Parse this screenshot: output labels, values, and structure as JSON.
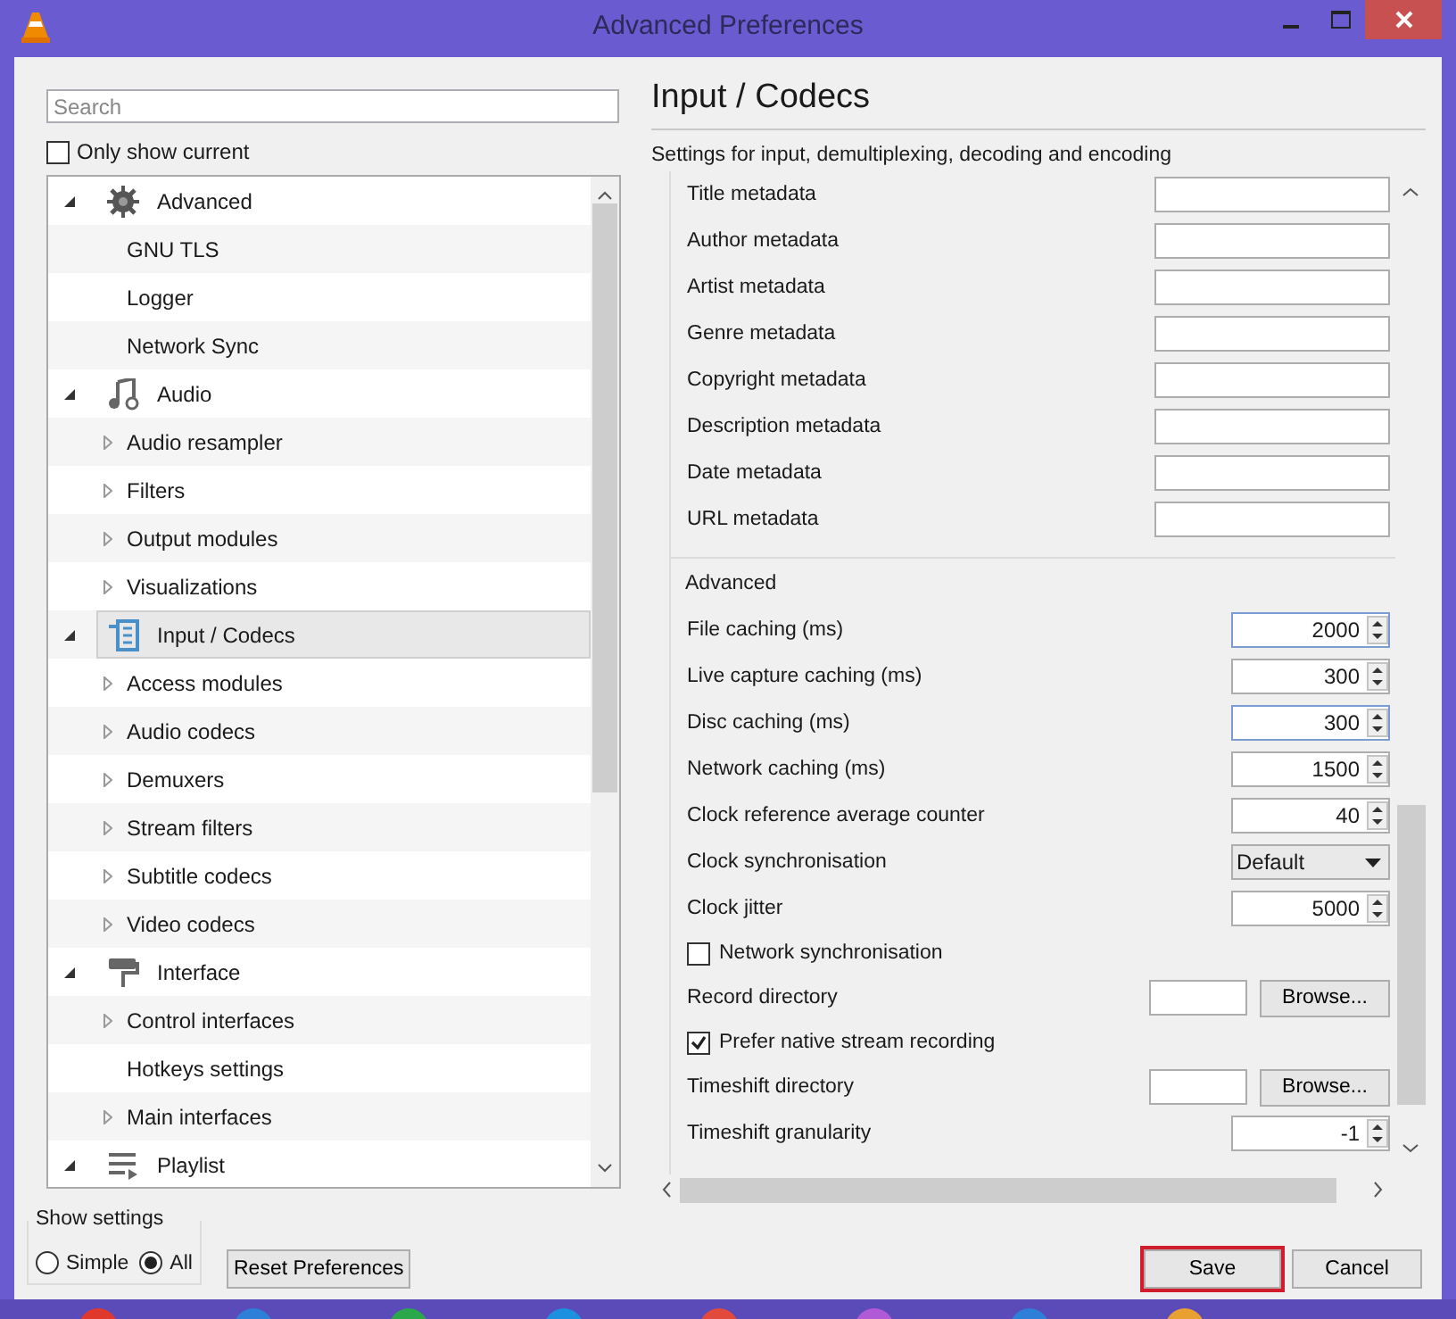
{
  "window": {
    "title": "Advanced Preferences"
  },
  "search": {
    "placeholder": "Search"
  },
  "only_show_current": {
    "label": "Only show current",
    "checked": false
  },
  "tree": [
    {
      "label": "Advanced",
      "expanded": true,
      "selected": false,
      "children": [
        {
          "label": "GNU TLS",
          "expandable": false,
          "selected": false
        },
        {
          "label": "Logger",
          "expandable": false,
          "selected": false
        },
        {
          "label": "Network Sync",
          "expandable": false,
          "selected": false
        }
      ]
    },
    {
      "label": "Audio",
      "expanded": true,
      "selected": false,
      "children": [
        {
          "label": "Audio resampler",
          "expandable": true,
          "selected": false
        },
        {
          "label": "Filters",
          "expandable": true,
          "selected": false
        },
        {
          "label": "Output modules",
          "expandable": true,
          "selected": false
        },
        {
          "label": "Visualizations",
          "expandable": true,
          "selected": false
        }
      ]
    },
    {
      "label": "Input / Codecs",
      "expanded": true,
      "selected": true,
      "children": [
        {
          "label": "Access modules",
          "expandable": true,
          "selected": false
        },
        {
          "label": "Audio codecs",
          "expandable": true,
          "selected": false
        },
        {
          "label": "Demuxers",
          "expandable": true,
          "selected": false
        },
        {
          "label": "Stream filters",
          "expandable": true,
          "selected": false
        },
        {
          "label": "Subtitle codecs",
          "expandable": true,
          "selected": false
        },
        {
          "label": "Video codecs",
          "expandable": true,
          "selected": false
        }
      ]
    },
    {
      "label": "Interface",
      "expanded": true,
      "selected": false,
      "children": [
        {
          "label": "Control interfaces",
          "expandable": true,
          "selected": false
        },
        {
          "label": "Hotkeys settings",
          "expandable": false,
          "selected": false
        },
        {
          "label": "Main interfaces",
          "expandable": true,
          "selected": false
        }
      ]
    },
    {
      "label": "Playlist",
      "expanded": true,
      "selected": false
    }
  ],
  "page": {
    "title": "Input / Codecs",
    "description": "Settings for input, demultiplexing, decoding and encoding"
  },
  "settings": [
    {
      "kind": "text",
      "label": "Title metadata"
    },
    {
      "kind": "text",
      "label": "Author metadata"
    },
    {
      "kind": "text",
      "label": "Artist metadata"
    },
    {
      "kind": "text",
      "label": "Genre metadata"
    },
    {
      "kind": "text",
      "label": "Copyright metadata"
    },
    {
      "kind": "text",
      "label": "Description metadata"
    },
    {
      "kind": "text",
      "label": "Date metadata"
    },
    {
      "kind": "text",
      "label": "URL metadata"
    },
    {
      "kind": "section",
      "label": "Advanced"
    },
    {
      "kind": "spin",
      "label": "File caching (ms)",
      "value": "2000",
      "focused": true
    },
    {
      "kind": "spin",
      "label": "Live capture caching (ms)",
      "value": "300",
      "focused": false
    },
    {
      "kind": "spin",
      "label": "Disc caching (ms)",
      "value": "300",
      "focused": true
    },
    {
      "kind": "spin",
      "label": "Network caching (ms)",
      "value": "1500",
      "focused": false
    },
    {
      "kind": "spin",
      "label": "Clock reference average counter",
      "value": "40",
      "focused": false
    },
    {
      "kind": "dropdown",
      "label": "Clock synchronisation",
      "value": "Default"
    },
    {
      "kind": "spin",
      "label": "Clock jitter",
      "value": "5000",
      "focused": false
    },
    {
      "kind": "checkbox",
      "label": "Network synchronisation",
      "checked": false
    },
    {
      "kind": "directory",
      "label": "Record directory",
      "button": "Browse..."
    },
    {
      "kind": "checkbox",
      "label": "Prefer native stream recording",
      "checked": true
    },
    {
      "kind": "directory",
      "label": "Timeshift directory",
      "button": "Browse..."
    },
    {
      "kind": "spin",
      "label": "Timeshift granularity",
      "value": "-1",
      "focused": false
    }
  ],
  "show_settings": {
    "label": "Show settings",
    "options": [
      {
        "label": "Simple",
        "selected": false
      },
      {
        "label": "All",
        "selected": true
      }
    ]
  },
  "buttons": [
    {
      "kind": "reset",
      "label": "Reset Preferences"
    },
    {
      "kind": "save",
      "label": "Save",
      "highlighted": true
    },
    {
      "kind": "cancel",
      "label": "Cancel"
    }
  ]
}
